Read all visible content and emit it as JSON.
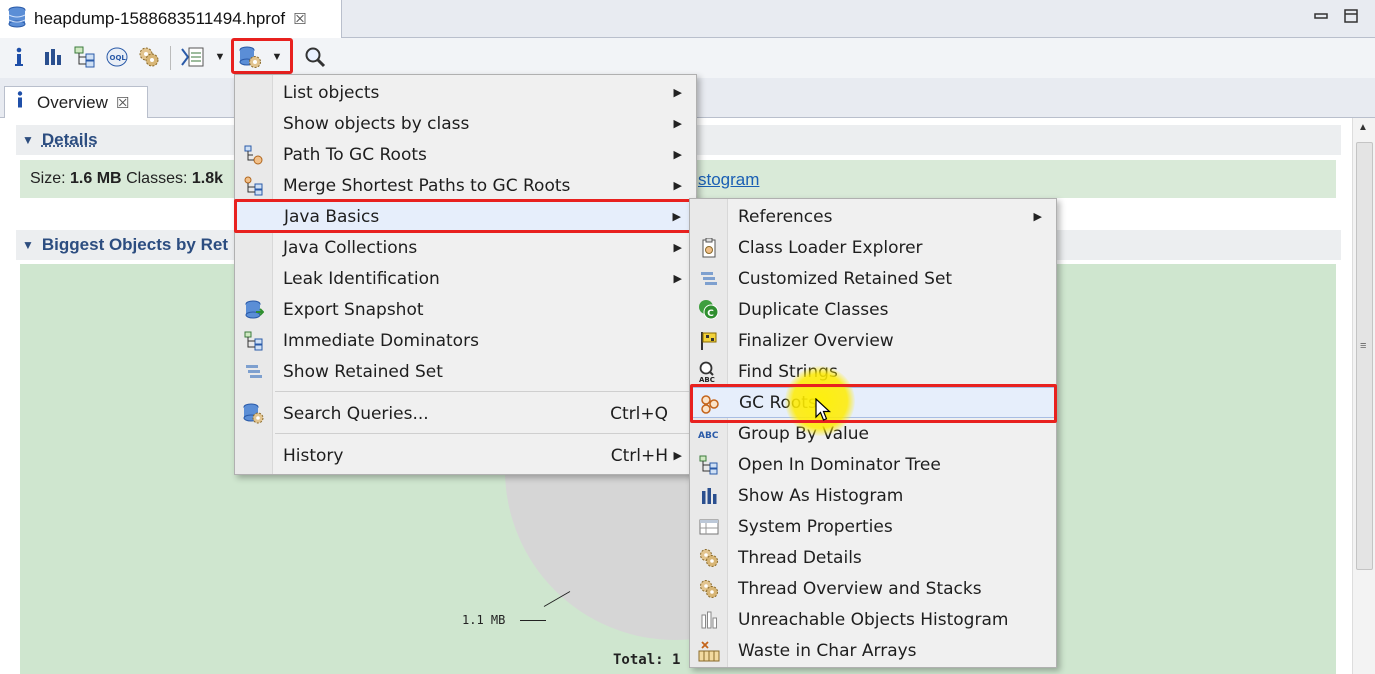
{
  "editor_tab": {
    "title": "heapdump-1588683511494.hprof",
    "close": "☒"
  },
  "window_controls": {
    "minimize": "▭",
    "maximize": "🗖"
  },
  "toolbar": {
    "buttons": [
      "info-icon",
      "histogram-icon",
      "dominator-tree-icon",
      "oql-icon",
      "thread-overview-icon",
      "reports-icon",
      "query-browser-icon",
      "search-icon"
    ],
    "oql_text": "OQL"
  },
  "view_tab": {
    "label": "Overview",
    "close": "☒"
  },
  "details": {
    "title": "Details",
    "size_label": "Size:",
    "size_value": "1.6 MB",
    "classes_label": "Classes:",
    "classes_value": "1.8k",
    "link_text": "stogram"
  },
  "biggest": {
    "title": "Biggest Objects by Ret"
  },
  "chart": {
    "slice_label": "1.1 MB",
    "total_label": "Total: 1"
  },
  "main_menu": {
    "items": [
      {
        "label": "List objects",
        "arrow": "▶"
      },
      {
        "label": "Show objects by class",
        "arrow": "▶"
      },
      {
        "label": "Path To GC Roots",
        "arrow": "▶",
        "icon": "path-to-gc-roots-icon"
      },
      {
        "label": "Merge Shortest Paths to GC Roots",
        "arrow": "▶",
        "icon": "merge-paths-icon"
      },
      {
        "label": "Java Basics",
        "arrow": "▶"
      },
      {
        "label": "Java Collections",
        "arrow": "▶"
      },
      {
        "label": "Leak Identification",
        "arrow": "▶"
      },
      {
        "label": "Export Snapshot",
        "icon": "export-snapshot-icon"
      },
      {
        "label": "Immediate Dominators",
        "icon": "immediate-dominators-icon"
      },
      {
        "label": "Show Retained Set",
        "icon": "retained-set-icon"
      },
      {
        "label": "Search Queries...",
        "shortcut": "Ctrl+Q",
        "icon": "search-queries-icon"
      },
      {
        "label": "History",
        "shortcut": "Ctrl+H",
        "arrow": "▶"
      }
    ]
  },
  "sub_menu": {
    "items": [
      {
        "label": "References",
        "arrow": "▶"
      },
      {
        "label": "Class Loader Explorer",
        "icon": "class-loader-icon"
      },
      {
        "label": "Customized Retained Set",
        "icon": "customized-retained-set-icon"
      },
      {
        "label": "Duplicate Classes",
        "icon": "duplicate-classes-icon"
      },
      {
        "label": "Finalizer Overview",
        "icon": "finalizer-icon"
      },
      {
        "label": "Find Strings",
        "icon": "find-strings-icon"
      },
      {
        "label": "GC Roots",
        "icon": "gc-roots-icon"
      },
      {
        "label": "Group By Value",
        "icon": "group-by-value-icon"
      },
      {
        "label": "Open In Dominator Tree",
        "icon": "dominator-tree-icon"
      },
      {
        "label": "Show As Histogram",
        "icon": "histogram-icon"
      },
      {
        "label": "System Properties",
        "icon": "system-properties-icon"
      },
      {
        "label": "Thread Details",
        "icon": "thread-details-icon"
      },
      {
        "label": "Thread Overview and Stacks",
        "icon": "thread-overview-icon"
      },
      {
        "label": "Unreachable Objects Histogram",
        "icon": "unreachable-histogram-icon"
      },
      {
        "label": "Waste in Char Arrays",
        "icon": "waste-char-arrays-icon"
      }
    ]
  },
  "colors": {
    "highlight_red": "#e8211f",
    "section_title": "#2c4d80",
    "details_bg": "#d9ead8",
    "chart_bg": "#cfe6cf",
    "cursor_glow": "#fff000"
  }
}
